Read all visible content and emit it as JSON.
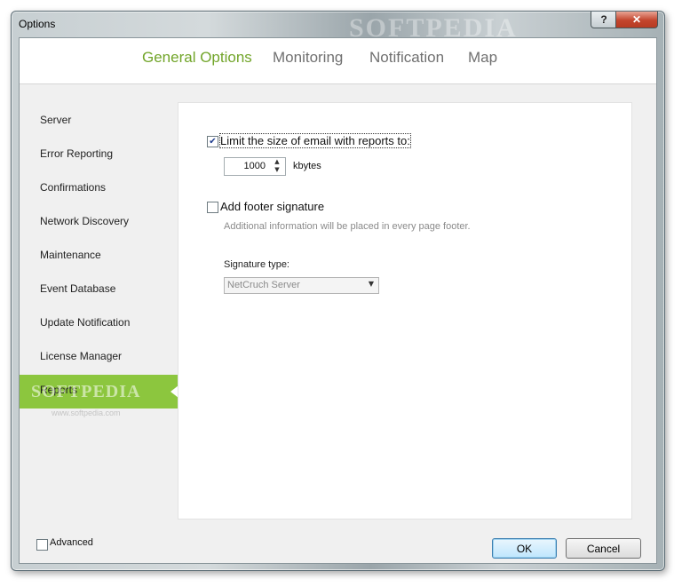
{
  "window": {
    "title": "Options",
    "watermark": "SOFTPEDIA",
    "help_symbol": "?",
    "close_symbol": "✕"
  },
  "tabs": [
    {
      "label": "General Options",
      "active": true
    },
    {
      "label": "Monitoring",
      "active": false
    },
    {
      "label": "Notification",
      "active": false
    },
    {
      "label": "Map",
      "active": false
    }
  ],
  "sidebar": {
    "items": [
      {
        "label": "Server"
      },
      {
        "label": "Error Reporting"
      },
      {
        "label": "Confirmations"
      },
      {
        "label": "Network Discovery"
      },
      {
        "label": "Maintenance"
      },
      {
        "label": "Event Database"
      },
      {
        "label": "Update Notification"
      },
      {
        "label": "License Manager"
      },
      {
        "label": "Reports"
      }
    ],
    "active_item": "Reports",
    "watermark": "SOFTPEDIA",
    "watermark_url": "www.softpedia.com",
    "accent_color": "#8cc63e"
  },
  "panel": {
    "limit_size": {
      "checked": true,
      "label": "Limit the size of email with reports to:"
    },
    "size_value": "1000",
    "size_unit": "kbytes",
    "footer": {
      "checked": false,
      "label": "Add footer signature"
    },
    "footer_hint": "Additional information will be placed in every page footer.",
    "signature_type_label": "Signature type:",
    "signature_type_value": "NetCruch Server"
  },
  "bottom": {
    "advanced": {
      "checked": false,
      "label": "Advanced"
    },
    "ok_label": "OK",
    "cancel_label": "Cancel"
  },
  "colors": {
    "active_tab": "#72a52a",
    "inactive_tab": "#707070"
  }
}
